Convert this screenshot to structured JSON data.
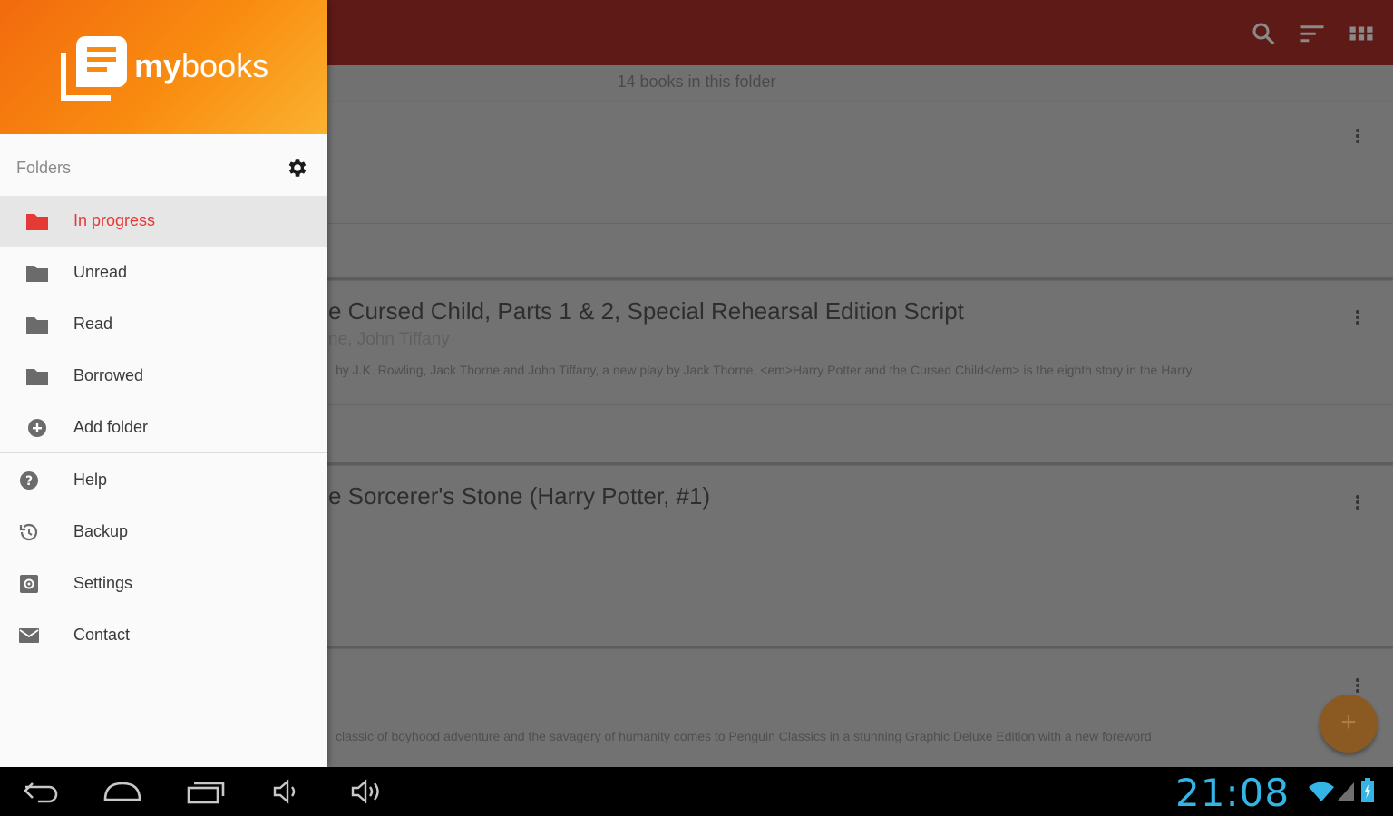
{
  "app": {
    "logo_prefix": "my",
    "logo_suffix": "books"
  },
  "toolbar": {
    "icons": [
      "search-icon",
      "sort-icon",
      "grid-view-icon"
    ]
  },
  "content": {
    "book_count": "14 books in this folder",
    "books": [
      {
        "title": "",
        "author": "",
        "description": ""
      },
      {
        "title": "e Cursed Child, Parts 1 & 2, Special Rehearsal Edition Script",
        "author": "ne, John Tiffany",
        "description": "by J.K. Rowling, Jack Thorne and John Tiffany, a new play by Jack Thorne, <em>Harry Potter and the Cursed Child</em> is the eighth story in the Harry"
      },
      {
        "title": "e Sorcerer's Stone (Harry Potter, #1)",
        "author": "",
        "description": ""
      },
      {
        "title": "",
        "author": "",
        "description": "classic of boyhood adventure and the savagery of humanity comes to Penguin Classics in a stunning Graphic Deluxe Edition with a new foreword"
      }
    ],
    "fab_label": "+"
  },
  "drawer": {
    "section_label": "Folders",
    "folders": [
      {
        "label": "In progress",
        "icon": "folder-icon",
        "active": true
      },
      {
        "label": "Unread",
        "icon": "folder-icon",
        "active": false
      },
      {
        "label": "Read",
        "icon": "folder-icon",
        "active": false
      },
      {
        "label": "Borrowed",
        "icon": "folder-icon",
        "active": false
      },
      {
        "label": "Add folder",
        "icon": "add-circle-icon",
        "active": false
      }
    ],
    "menu": [
      {
        "label": "Help",
        "icon": "help-icon"
      },
      {
        "label": "Backup",
        "icon": "backup-icon"
      },
      {
        "label": "Settings",
        "icon": "settings-icon"
      },
      {
        "label": "Contact",
        "icon": "mail-icon"
      }
    ]
  },
  "system_bar": {
    "time": "21:08",
    "buttons": [
      "back-icon",
      "home-icon",
      "recent-apps-icon",
      "volume-down-icon",
      "volume-up-icon"
    ]
  },
  "colors": {
    "header_orange": "#f98c10",
    "toolbar_red": "#5e1a16",
    "active_red": "#e53935",
    "clock_blue": "#33b5e5"
  }
}
